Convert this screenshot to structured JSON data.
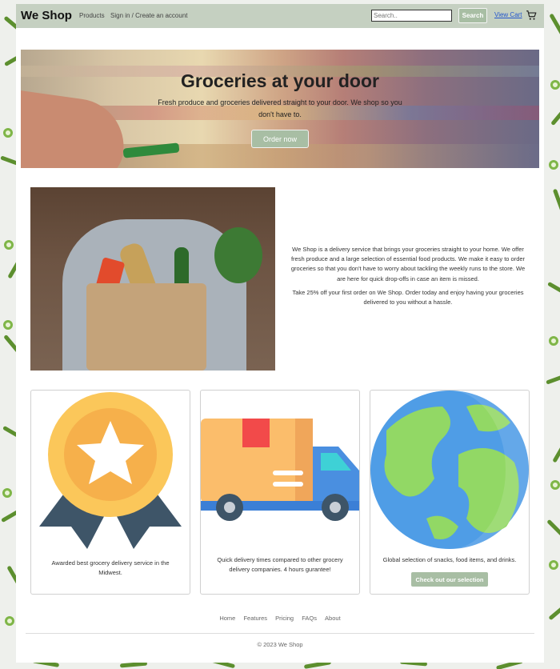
{
  "header": {
    "brand": "We Shop",
    "nav": [
      "Products",
      "Sign in / Create an account"
    ],
    "search_placeholder": "Search..",
    "search_button": "Search",
    "view_cart": "View Cart",
    "cart_icon": "cart-icon"
  },
  "hero": {
    "title": "Groceries at your door",
    "subtitle": "Fresh produce and groceries delivered straight to your door. We shop so you don't have to.",
    "button": "Order now"
  },
  "about": {
    "paragraph1": "We Shop is a delivery service that brings your groceries straight to your home. We offer fresh produce and a large selection of essential food products. We make it easy to order groceries so that you don't have to worry about tackling the weekly runs to the store. We are here for quick drop-offs in case an item is missed.",
    "paragraph2": "Take 25% off your first order on We Shop. Order today and enjoy having your groceries delivered to you without a hassle."
  },
  "features": [
    {
      "icon": "award-medal-icon",
      "text": "Awarded best grocery delivery service in the Midwest."
    },
    {
      "icon": "delivery-truck-icon",
      "text": "Quick delivery times compared to other grocery delivery companies. 4 hours gurantee!"
    },
    {
      "icon": "globe-icon",
      "text": "Global selection of snacks, food items, and drinks.",
      "button": "Check out our selection"
    }
  ],
  "footer": {
    "links": [
      "Home",
      "Features",
      "Pricing",
      "FAQs",
      "About"
    ],
    "copyright": "© 2023 We Shop"
  },
  "colors": {
    "navbar": "#c5d0c1",
    "accent_button": "#a8bea4"
  }
}
